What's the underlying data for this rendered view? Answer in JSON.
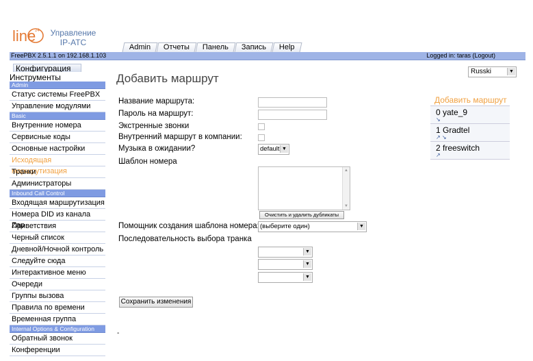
{
  "app": {
    "logo_text": "line",
    "logo_sup": "24",
    "logo_caption_1": "Управление",
    "logo_caption_2": "IP-АТС"
  },
  "tabs": [
    "Admin",
    "Отчеты",
    "Панель",
    "Запись",
    "Help"
  ],
  "topbar": {
    "version": "FreePBX 2.5.1.1 on 192.168.1.103",
    "logged_in": "Logged in: taras (Logout)"
  },
  "side_tabs": {
    "config": "Конфигурация",
    "tools": "Инструменты"
  },
  "sidebar": [
    {
      "type": "section",
      "label": "Admin"
    },
    {
      "type": "item",
      "label": "Статус системы FreePBX"
    },
    {
      "type": "item",
      "label": "Управление модулями"
    },
    {
      "type": "section",
      "label": "Basic"
    },
    {
      "type": "item",
      "label": "Внутренние номера"
    },
    {
      "type": "item",
      "label": "Сервисные коды"
    },
    {
      "type": "item",
      "label": "Основные настройки"
    },
    {
      "type": "item",
      "label": "Исходящая маршрутизация",
      "active": true
    },
    {
      "type": "item",
      "label": "Транки"
    },
    {
      "type": "item",
      "label": "Администраторы"
    },
    {
      "type": "section",
      "label": "Inbound Call Control"
    },
    {
      "type": "item",
      "label": "Входящая маршрутизация"
    },
    {
      "type": "item",
      "label": "Номера DID из канала Zap"
    },
    {
      "type": "item",
      "label": "Приветствия"
    },
    {
      "type": "item",
      "label": "Черный список"
    },
    {
      "type": "item",
      "label": "Дневной/Ночной контроль"
    },
    {
      "type": "item",
      "label": "Следуйте сюда"
    },
    {
      "type": "item",
      "label": "Интерактивное меню"
    },
    {
      "type": "item",
      "label": "Очереди"
    },
    {
      "type": "item",
      "label": "Группы вызова"
    },
    {
      "type": "item",
      "label": "Правила по времени"
    },
    {
      "type": "item",
      "label": "Временная группа"
    },
    {
      "type": "section",
      "label": "Internal Options & Configuration"
    },
    {
      "type": "item",
      "label": "Обратный звонок"
    },
    {
      "type": "item",
      "label": "Конференции"
    }
  ],
  "main": {
    "title": "Добавить маршрут",
    "language": "Russki",
    "route_name_label": "Название маршрута:",
    "route_name_value": "",
    "route_password_label": "Пароль на маршрут:",
    "route_password_value": "",
    "emergency_label": "Экстренные звонки",
    "intra_company_label": "Внутренний маршрут в компании:",
    "moh_label": "Музыка в ожидании?",
    "moh_value": "default",
    "dial_pattern_label": "Шаблон номера",
    "clean_button": "Очистить и удалить дубликаты",
    "pattern_wizard_label": "Помощник создания шаблона номера:",
    "pattern_wizard_value": "(выберите один)",
    "trunk_sequence_label": "Последовательность выбора транка",
    "trunk_selects": [
      "",
      "",
      ""
    ],
    "save_button": "Сохранить изменения",
    "footer_mark": "-"
  },
  "right_panel": {
    "header": "Добавить маршрут",
    "routes": [
      {
        "label": "0 yate_9",
        "arrows": "↘"
      },
      {
        "label": "1 Gradtel",
        "arrows": "↗ ↘"
      },
      {
        "label": "2 freeswitch",
        "arrows": "↗"
      }
    ]
  }
}
